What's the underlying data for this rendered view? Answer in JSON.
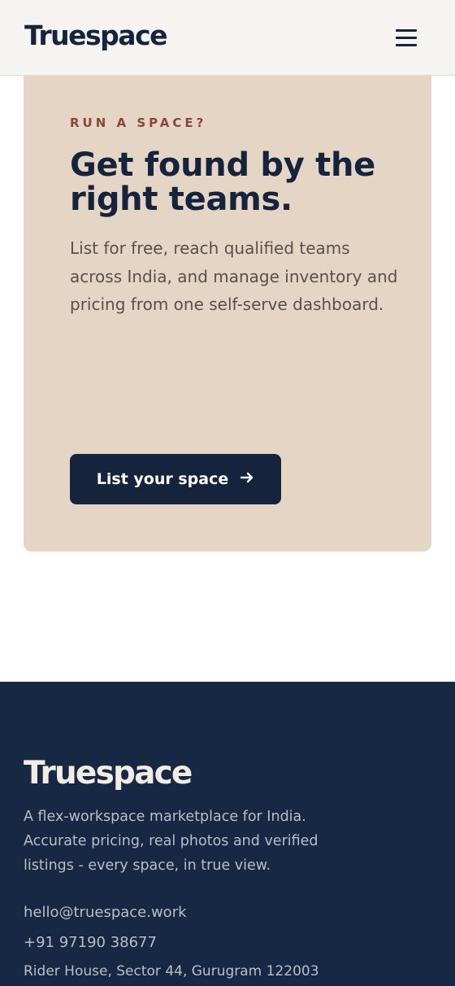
{
  "header": {
    "logo": "Truespace",
    "menu_icon": "hamburger-menu-icon"
  },
  "promo": {
    "eyebrow": "RUN A SPACE?",
    "headline": "Get found by the right teams.",
    "body": "List for free, reach qualified teams across India, and manage inventory and pricing from one self-serve dashboard.",
    "cta_label": "List your space",
    "cta_icon": "arrow-right-icon"
  },
  "footer": {
    "logo": "Truespace",
    "description": "A flex-workspace marketplace for India. Accurate pricing, real photos and verified listings - every space, in true view.",
    "email": "hello@truespace.work",
    "phone": "+91 97190 38677",
    "address": "Rider House, Sector 44, Gurugram 122003"
  },
  "colors": {
    "navy": "#16233d",
    "card_beige": "#e4d5c4",
    "eyebrow_rust": "#87483a",
    "footer_navy": "#162843"
  }
}
